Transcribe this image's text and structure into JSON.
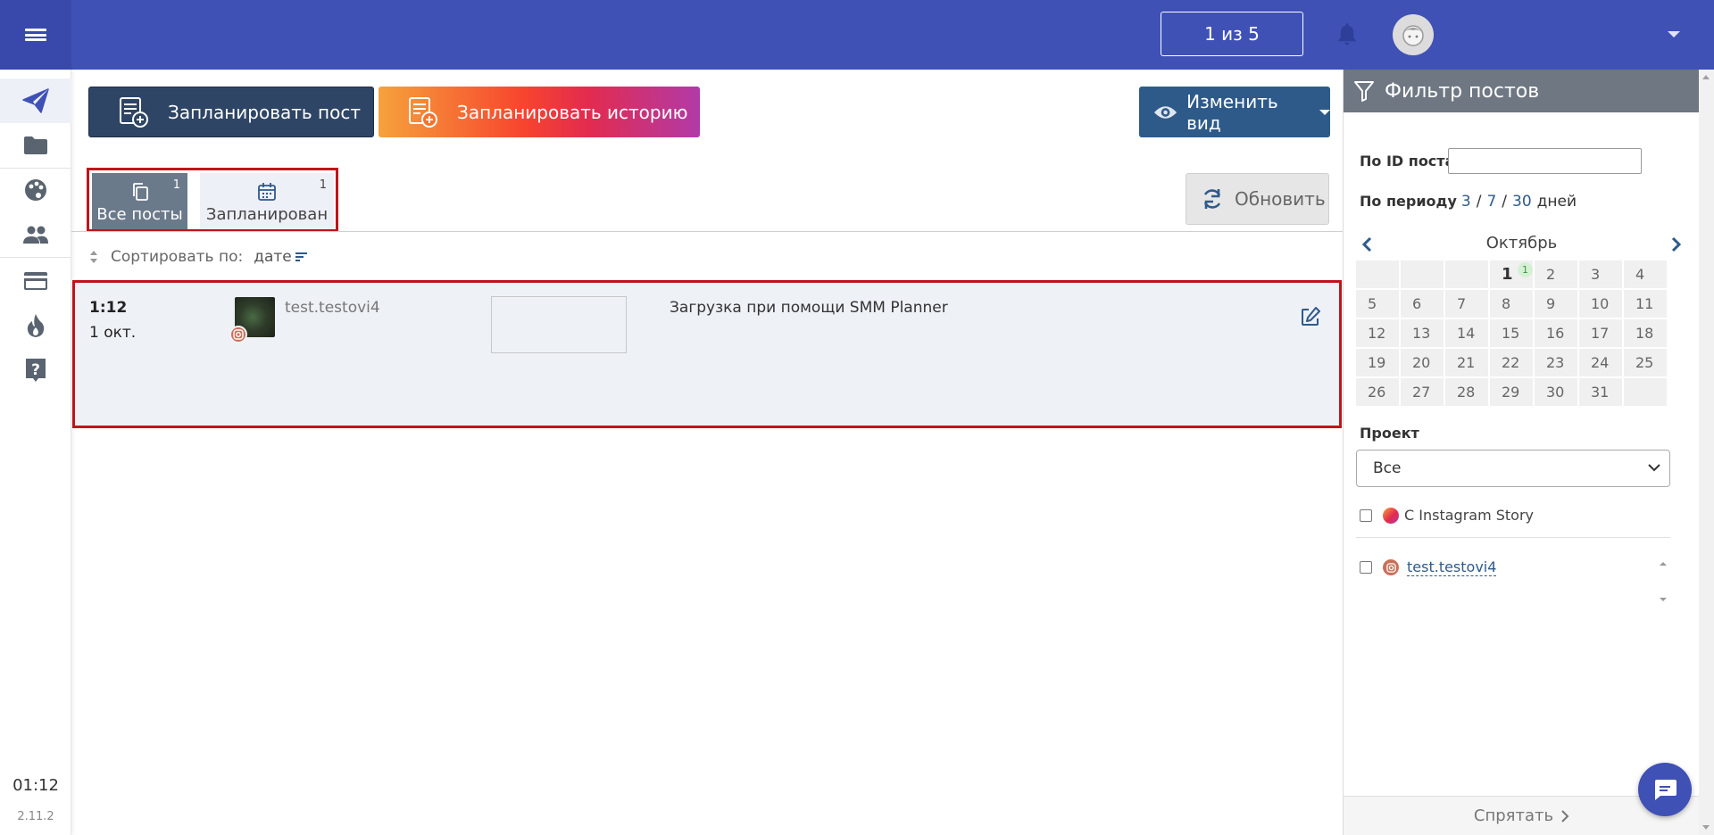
{
  "header": {
    "counter": "1 из 5",
    "icons": {
      "menu": "menu-icon",
      "bell": "bell-icon",
      "avatar": "avatar-icon"
    }
  },
  "sidebar": {
    "items": [
      "send-icon",
      "folder-icon",
      "palette-icon",
      "people-icon",
      "card-icon",
      "fire-icon",
      "help-icon"
    ],
    "time": "01:12",
    "version": "2.11.2"
  },
  "toolbar": {
    "plan_post": "Запланировать пост",
    "plan_story": "Запланировать историю",
    "change_view": "Изменить вид",
    "refresh": "Обновить"
  },
  "tabs": [
    {
      "label": "Все посты",
      "count": "1"
    },
    {
      "label": "Запланирован",
      "count": "1"
    }
  ],
  "sort": {
    "label": "Сортировать по:",
    "value": "дате"
  },
  "post": {
    "time": "1:12",
    "date": "1 окт.",
    "account": "test.testovi4",
    "text": "Загрузка при помощи SMM Planner"
  },
  "filter": {
    "title": "Фильтр постов",
    "by_id_label": "По ID поста",
    "by_period_label": "По периоду",
    "periods": [
      "3",
      "7",
      "30"
    ],
    "period_unit": "дней",
    "calendar": {
      "month": "Октябрь",
      "leading_blanks": 3,
      "days": [
        "1",
        "2",
        "3",
        "4",
        "5",
        "6",
        "7",
        "8",
        "9",
        "10",
        "11",
        "12",
        "13",
        "14",
        "15",
        "16",
        "17",
        "18",
        "19",
        "20",
        "21",
        "22",
        "23",
        "24",
        "25",
        "26",
        "27",
        "28",
        "29",
        "30",
        "31"
      ],
      "trailing_blanks": 1,
      "today": "1",
      "today_badge": "1"
    },
    "project_label": "Проект",
    "project_value": "Все",
    "story_label": "С Instagram Story",
    "account_label": "test.testovi4",
    "hide_label": "Спрятать"
  },
  "colors": {
    "header": "#3f51b5",
    "primary_button": "#2e4566",
    "view_button": "#2e5a8a",
    "highlight_border": "#c0141b"
  }
}
